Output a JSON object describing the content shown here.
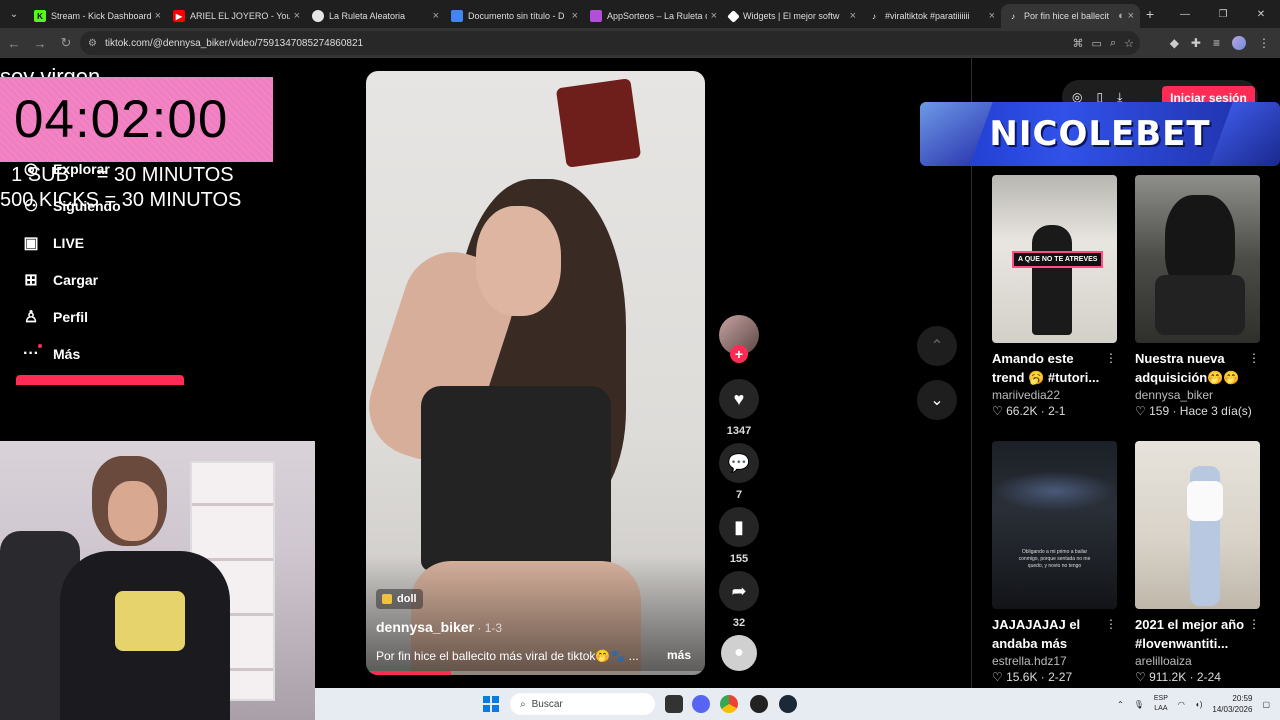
{
  "browser": {
    "tabs": [
      {
        "title": "Stream - Kick Dashboard",
        "favicon_color": "#53fc18",
        "active": false
      },
      {
        "title": "ARIEL EL JOYERO - YouTube",
        "favicon_color": "#ff0000",
        "active": false
      },
      {
        "title": "La Ruleta Aleatoria",
        "favicon_color": "#e6e6e6",
        "active": false
      },
      {
        "title": "Documento sin título - D",
        "favicon_color": "#4285f4",
        "active": false
      },
      {
        "title": "AppSorteos – La Ruleta d",
        "favicon_color": "#b14fd9",
        "active": false
      },
      {
        "title": "Widgets | El mejor softw",
        "favicon_color": "#ffffff",
        "active": false
      },
      {
        "title": "#viraltiktok #paratiiiiiii",
        "favicon_color": "#111111",
        "active": false
      },
      {
        "title": "Por fin hice el ballecit",
        "favicon_color": "#111111",
        "active": true
      }
    ],
    "url": "tiktok.com/@dennysa_biker/video/7591347085274860821"
  },
  "overlay": {
    "top_text": "soy virgen",
    "timer": "04:02:00",
    "rule1": "  1 SUB     = 30 MINUTOS",
    "rule2": "500 KICKS = 30 MINUTOS"
  },
  "sidebar": {
    "items": [
      {
        "label": "Explorar",
        "icon": "compass-icon"
      },
      {
        "label": "Siguiendo",
        "icon": "following-icon"
      },
      {
        "label": "LIVE",
        "icon": "live-icon"
      },
      {
        "label": "Cargar",
        "icon": "upload-icon"
      },
      {
        "label": "Perfil",
        "icon": "profile-icon"
      },
      {
        "label": "Más",
        "icon": "more-icon"
      }
    ]
  },
  "video": {
    "tag": "doll",
    "author": "dennysa_biker",
    "date": " · 1-3",
    "caption": "Por fin hice el ballecito más viral de tiktok🤭🐾 ...",
    "more_label": "más",
    "progress": 0.25
  },
  "actions": {
    "likes": "1347",
    "comments": "7",
    "saves": "155",
    "shares": "32"
  },
  "header": {
    "login_label": "Iniciar sesión",
    "banner_text": "NICOLEBET"
  },
  "recommended": [
    {
      "title": "Amando este trend 🥱 #tutori...",
      "user": "mariivedia22",
      "meta": "♡ 66.2K · 2-1",
      "thumb_label": "A QUE NO TE ATREVES"
    },
    {
      "title": "Nuestra nueva adquisición🤭🤭 ...",
      "user": "dennysa_biker",
      "meta": "♡ 159 · Hace 3 día(s)",
      "thumb_label": ""
    },
    {
      "title": "JAJAJAJAJ el andaba más para...",
      "user": "estrella.hdz17",
      "meta": "♡ 15.6K · 2-27",
      "thumb_label": "Obligando a mi primo a bailar conmigo, porque sentada no me quedo, y novio no tengo"
    },
    {
      "title": "2021 el mejor año #lovenwantiti...",
      "user": "arelilloaiza",
      "meta": "♡ 911.2K · 2-24",
      "thumb_label": ""
    }
  ],
  "taskbar": {
    "search_placeholder": "Buscar",
    "lang1": "ESP",
    "lang2": "LAA",
    "time": "20:59",
    "date": "14/03/2026"
  }
}
